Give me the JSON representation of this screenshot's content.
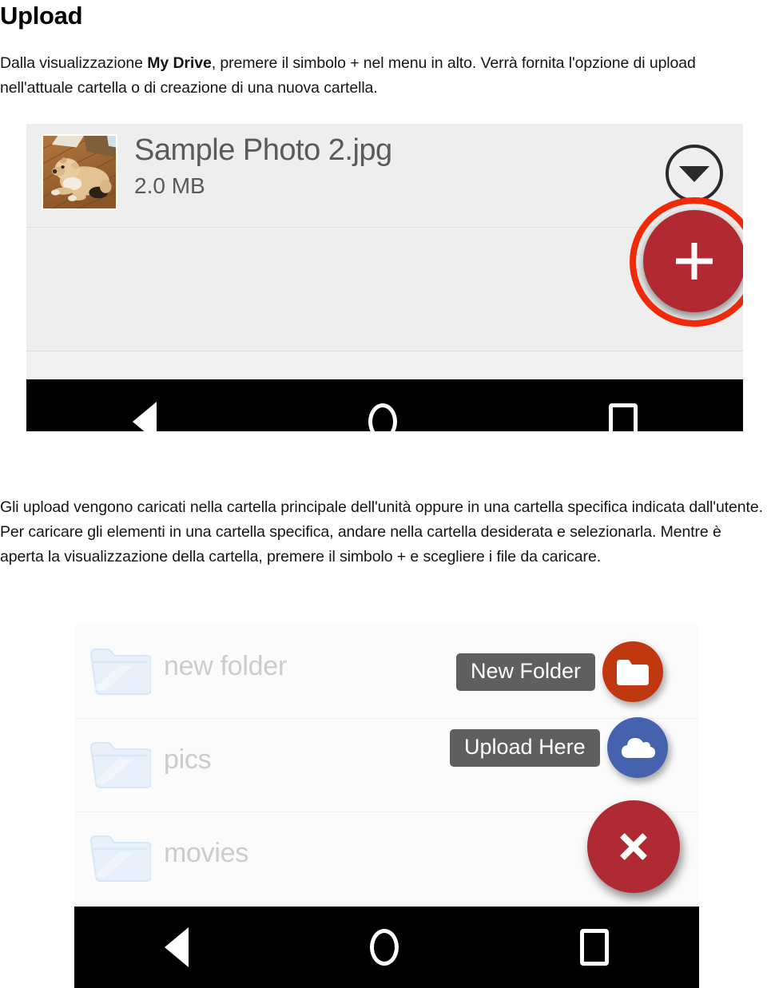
{
  "document": {
    "title": "Upload",
    "intro_paragraph": {
      "before_bold": "Dalla visualizzazione ",
      "bold": "My Drive",
      "after_bold": ", premere il simbolo + nel menu in alto. Verrà fornita l'opzione di upload nell'attuale cartella o di creazione di una nuova cartella."
    },
    "middle_paragraph": "Gli upload vengono caricati nella cartella principale dell'unità oppure in una cartella specifica indicata dall'utente. Per caricare gli elementi in una cartella specifica, andare nella cartella desiderata e selezionarla. Mentre è aperta la visualizzazione della cartella, premere il simbolo + e scegliere i file da caricare."
  },
  "screenshot_one": {
    "file_row": {
      "name": "Sample Photo 2.jpg",
      "size": "2.0 MB",
      "thumbnail_alt": "puppy-photo-thumbnail"
    },
    "dropdown_button_icon": "chevron-down-icon",
    "fab": {
      "icon": "plus-icon",
      "color": "#b22a31"
    },
    "annotation_ring_color": "#f02a08",
    "navbar": {
      "back": "back-triangle-icon",
      "home": "home-circle-icon",
      "recents": "recents-square-icon"
    }
  },
  "screenshot_two": {
    "folders": [
      {
        "name": "new folder"
      },
      {
        "name": "pics"
      },
      {
        "name": "movies"
      }
    ],
    "speed_dial": [
      {
        "label": "New Folder",
        "icon": "folder-icon",
        "color": "#bf380f"
      },
      {
        "label": "Upload Here",
        "icon": "cloud-upload-icon",
        "color": "#4462ad"
      }
    ],
    "close_fab": {
      "icon": "close-x-icon",
      "color": "#b02a33"
    },
    "navbar": {
      "back": "back-triangle-icon",
      "home": "home-circle-icon",
      "recents": "recents-square-icon"
    }
  }
}
